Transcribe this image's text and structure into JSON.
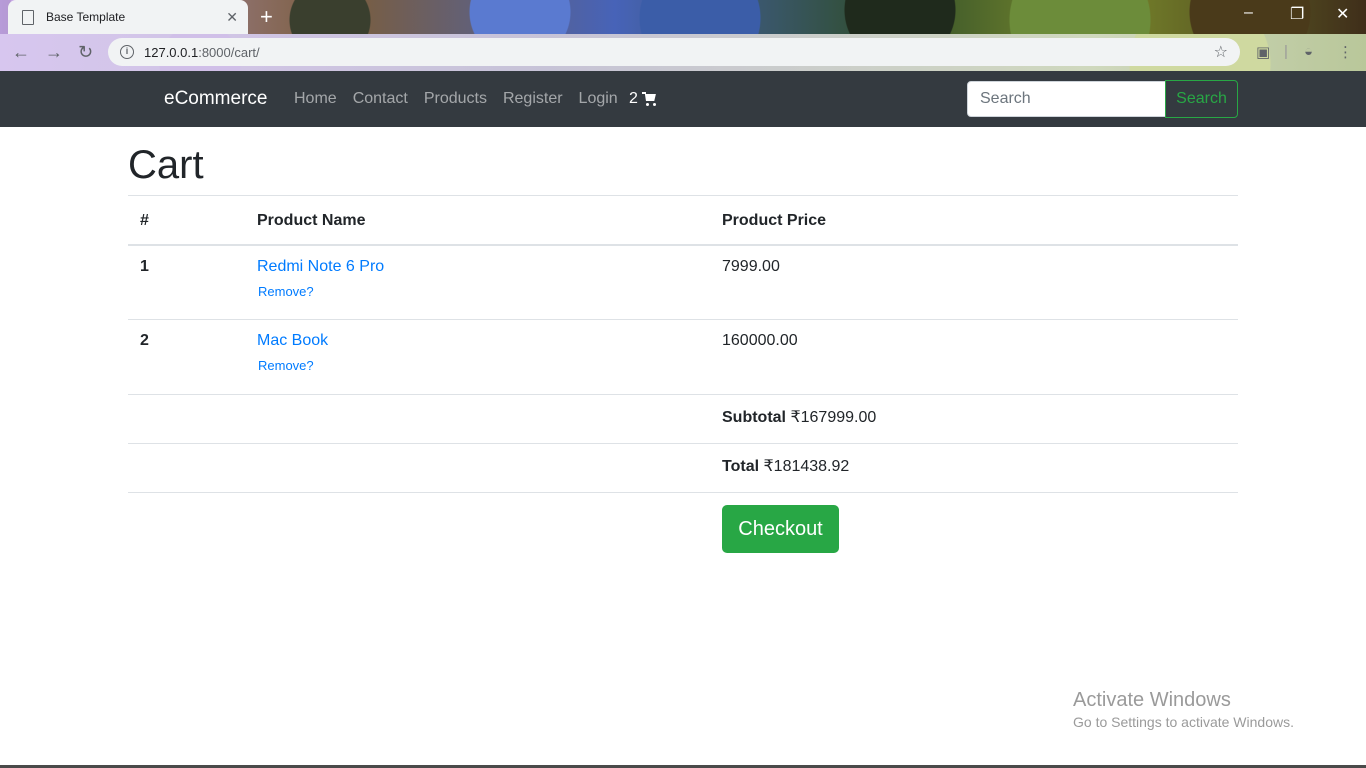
{
  "browser": {
    "tab_title": "Base Template",
    "url_host": "127.0.0.1",
    "url_path": ":8000/cart/"
  },
  "navbar": {
    "brand": "eCommerce",
    "links": [
      "Home",
      "Contact",
      "Products",
      "Register",
      "Login"
    ],
    "cart_count": "2",
    "search_placeholder": "Search",
    "search_button": "Search"
  },
  "page": {
    "title": "Cart",
    "table": {
      "headers": [
        "#",
        "Product Name",
        "Product Price"
      ],
      "rows": [
        {
          "num": "1",
          "name": "Redmi Note 6 Pro",
          "remove": "Remove?",
          "price": "7999.00"
        },
        {
          "num": "2",
          "name": "Mac Book",
          "remove": "Remove?",
          "price": "160000.00"
        }
      ],
      "subtotal_label": "Subtotal",
      "subtotal_value": "₹167999.00",
      "total_label": "Total",
      "total_value": "₹181438.92",
      "checkout": "Checkout"
    }
  },
  "watermark": {
    "title": "Activate Windows",
    "subtitle": "Go to Settings to activate Windows."
  },
  "colors": {
    "navbar_bg": "#343a40",
    "link": "#007bff",
    "success": "#28a745"
  }
}
